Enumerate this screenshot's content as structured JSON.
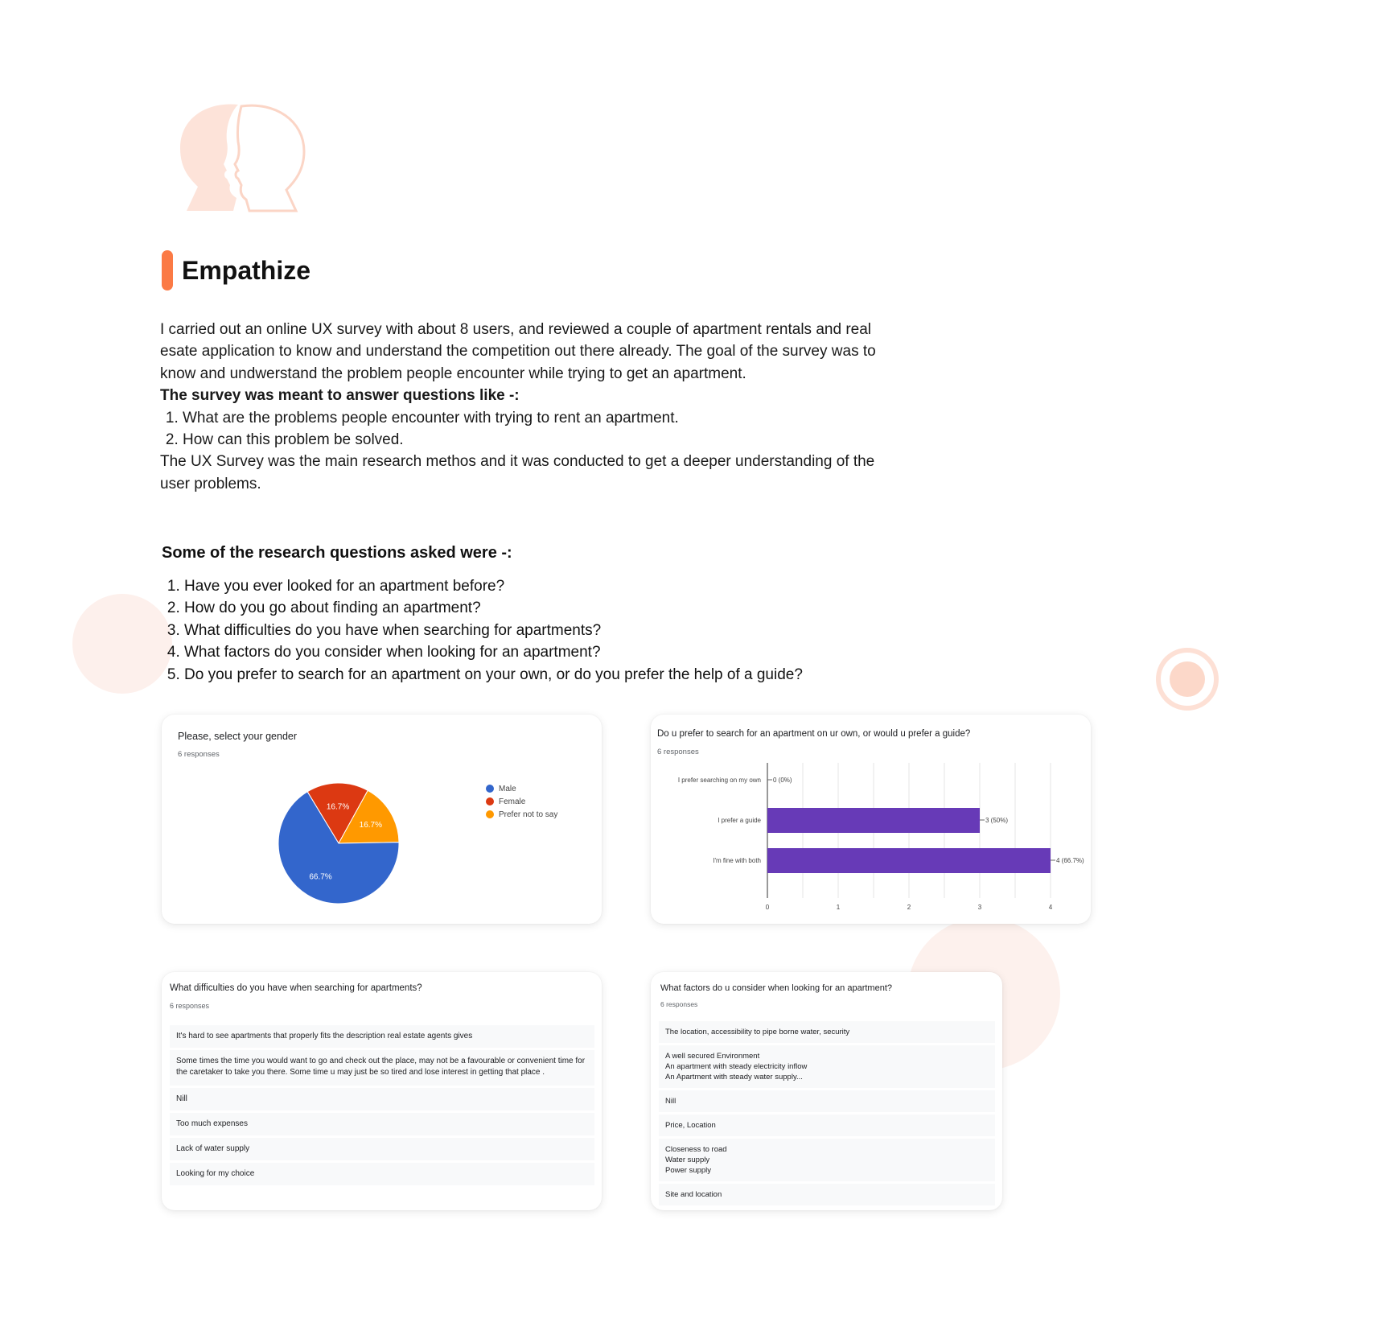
{
  "section": {
    "title": "Empathize",
    "intro": "I carried out an online UX survey with about 8 users, and reviewed a couple of apartment rentals and real esate application to know and understand the competition out there already. The goal of the survey was to know and undwerstand the problem people encounter while trying to get an apartment.",
    "survey_goal_heading": "The survey was meant to answer questions like -:",
    "survey_goals": [
      "What are the problems people encounter with trying to rent an apartment.",
      "How can this problem be solved."
    ],
    "method_note": "The UX Survey was the main research methos and it was conducted to get a deeper understanding of the user problems."
  },
  "research": {
    "heading": "Some of the research questions asked were -:",
    "questions": [
      "Have you ever looked for an apartment before?",
      "How do you go about finding an apartment?",
      "What difficulties do you have when searching for apartments?",
      "What factors do you consider when looking for an apartment?",
      "Do you prefer to search for an apartment on your own, or do you prefer the help of a guide?"
    ]
  },
  "icons": {
    "head": "two-heads-profile-icon"
  },
  "colors": {
    "accent": "#fb7a45",
    "bar": "#673ab7",
    "male": "#3366cc",
    "female": "#dc3912",
    "prefer_not": "#ff9900"
  },
  "chart_data": [
    {
      "type": "pie",
      "title": "Please, select your gender",
      "subtitle": "6 responses",
      "slices": [
        {
          "label": "Male",
          "value": 66.7,
          "display": "66.7%",
          "color": "#3366cc"
        },
        {
          "label": "Female",
          "value": 16.7,
          "display": "16.7%",
          "color": "#dc3912"
        },
        {
          "label": "Prefer not to say",
          "value": 16.7,
          "display": "16.7%",
          "color": "#ff9900"
        }
      ],
      "legend_position": "right"
    },
    {
      "type": "bar",
      "orientation": "horizontal",
      "title": "Do u prefer to search for an apartment on ur own, or would u prefer a guide?",
      "subtitle": "6 responses",
      "categories": [
        "I prefer searching on my own",
        "I prefer a guide",
        "I'm fine with both"
      ],
      "values": [
        0,
        3,
        4
      ],
      "value_labels": [
        "0 (0%)",
        "3 (50%)",
        "4 (66.7%)"
      ],
      "xlim": [
        0,
        4
      ],
      "xticks": [
        "0",
        "1",
        "2",
        "3",
        "4"
      ],
      "grid": true
    }
  ],
  "difficulties": {
    "question": "What difficulties do you have when searching for apartments?",
    "responses_label": "6 responses",
    "responses": [
      "It's hard to see apartments that properly fits the description real estate agents gives",
      "Some times the time you would want to go and check out the place, may not be a favourable or convenient time for the caretaker to take you there. Some time u may just be so tired and lose interest in getting that place .",
      "Nill",
      "Too much expenses",
      "Lack of water supply",
      "Looking for my choice"
    ]
  },
  "factors": {
    "question": "What factors do u consider when looking for an apartment?",
    "responses_label": "6 responses",
    "responses": [
      "The location, accessibility to pipe borne water, security",
      "A well secured Environment\nAn apartment with steady electricity inflow\nAn Apartment with steady water supply...",
      "Nill",
      "Price, Location",
      "Closeness to road\nWater supply\nPower supply",
      "Site and location"
    ]
  }
}
